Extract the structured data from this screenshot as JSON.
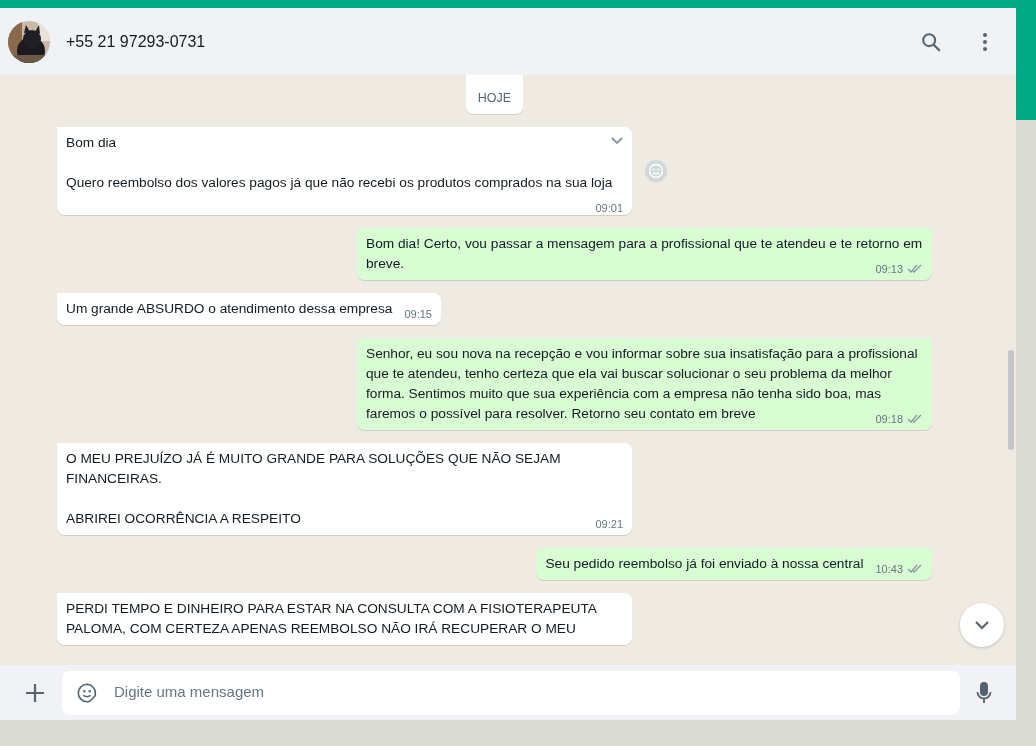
{
  "header": {
    "contact": "+55 21 97293-0731"
  },
  "chat": {
    "date_chip": "HOJE",
    "messages": [
      {
        "sent": false,
        "text": "Bom dia\n\nQuero reembolso dos valores pagos já que não recebi os produtos comprados na sua loja",
        "time": "09:01",
        "hovered": true
      },
      {
        "sent": true,
        "text": "Bom dia! Certo, vou passar a mensagem para a profissional que te atendeu e te retorno em breve.",
        "time": "09:13",
        "read": false,
        "hovered": false
      },
      {
        "sent": false,
        "text": "Um grande ABSURDO o atendimento dessa empresa",
        "time": "09:15",
        "hovered": false
      },
      {
        "sent": true,
        "text": "Senhor, eu sou nova na recepção e vou informar sobre sua insatisfação para a profissional que te atendeu, tenho certeza que ela vai buscar solucionar o seu problema da melhor forma. Sentimos muito que sua experiência com a empresa não tenha sido boa, mas faremos o possível para resolver. Retorno seu contato em breve",
        "time": "09:18",
        "read": false,
        "hovered": false
      },
      {
        "sent": false,
        "text": "O MEU PREJUÍZO JÁ É MUITO GRANDE PARA SOLUÇÕES QUE NÃO SEJAM FINANCEIRAS.\n\nABRIREI OCORRÊNCIA A RESPEITO",
        "time": "09:21",
        "hovered": false
      },
      {
        "sent": true,
        "text": "Seu pedido reembolso já foi enviado à nossa central",
        "time": "10:43",
        "read": false,
        "hovered": false
      },
      {
        "sent": false,
        "text": "PERDI TEMPO E DINHEIRO PARA ESTAR NA CONSULTA COM A FISIOTERAPEUTA PALOMA, COM CERTEZA APENAS REEMBOLSO NÃO IRÁ RECUPERAR O MEU",
        "hovered": false
      }
    ]
  },
  "composer": {
    "placeholder": "Digite uma mensagem"
  }
}
